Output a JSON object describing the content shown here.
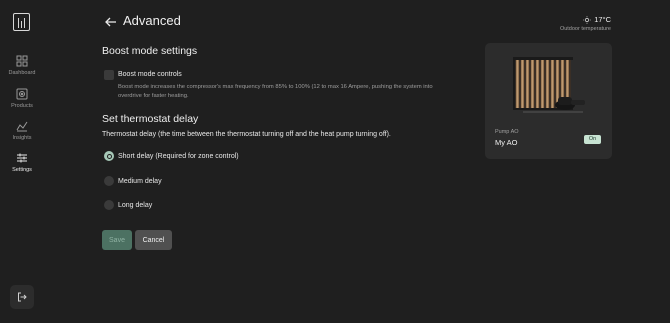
{
  "nav": {
    "items": [
      {
        "label": "Dashboard",
        "icon": "grid-icon"
      },
      {
        "label": "Products",
        "icon": "product-icon"
      },
      {
        "label": "Insights",
        "icon": "chart-icon"
      },
      {
        "label": "Settings",
        "icon": "sliders-icon"
      }
    ],
    "active": "Settings"
  },
  "header": {
    "title": "Advanced",
    "weather": {
      "temperature": "17°C",
      "label": "Outdoor temperature"
    }
  },
  "boost": {
    "title": "Boost mode settings",
    "checkbox_label": "Boost mode controls",
    "description": "Boost mode increases the compressor's max frequency from 85% to 100% (12 to max 16 Ampere, pushing the system into overdrive for faster heating.",
    "checked": false
  },
  "thermostat": {
    "title": "Set thermostat delay",
    "description": "Thermostat delay (the time between the thermostat turning off and the heat pump turning off).",
    "options": [
      {
        "label": "Short delay (Required for zone control)",
        "selected": true
      },
      {
        "label": "Medium delay",
        "selected": false
      },
      {
        "label": "Long delay",
        "selected": false
      }
    ]
  },
  "actions": {
    "save_label": "Save",
    "cancel_label": "Cancel"
  },
  "device_card": {
    "subtitle": "Pump AO",
    "name": "My AO",
    "status": "On",
    "accent": "#c7e3d2"
  },
  "colors": {
    "background": "#1f1f1f",
    "card": "#2c2c2c",
    "accent": "#a7c9b8"
  }
}
